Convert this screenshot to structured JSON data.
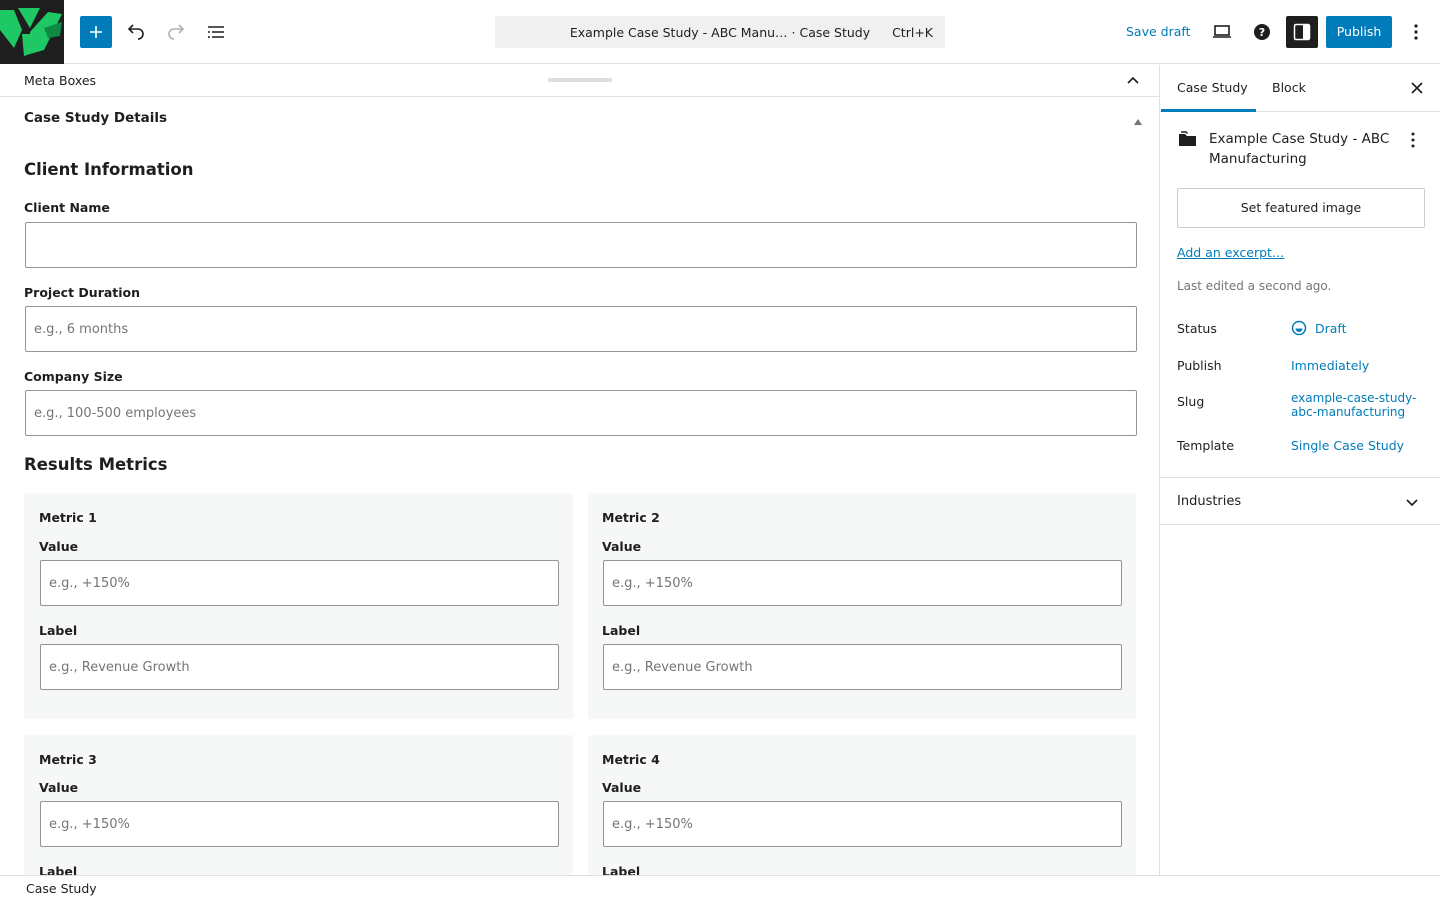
{
  "header": {
    "logo_icon": "site-logo-icon",
    "add_icon": "plus-icon",
    "undo_icon": "undo-icon",
    "redo_icon": "redo-icon",
    "list_view_icon": "list-view-icon",
    "command_title": "Example Case Study - ABC Manu… · Case Study",
    "command_shortcut": "Ctrl+K",
    "save_draft": "Save draft",
    "preview_icon": "laptop-icon",
    "help_icon": "help-icon",
    "settings_icon": "sidebar-toggle-icon",
    "publish": "Publish",
    "more_icon": "more-vertical-icon",
    "accent_color": "#007cba"
  },
  "meta_boxes": {
    "title": "Meta Boxes",
    "panel_title": "Case Study Details",
    "client_section": "Client Information",
    "fields": [
      {
        "label": "Client Name",
        "value": "",
        "placeholder": ""
      },
      {
        "label": "Project Duration",
        "value": "",
        "placeholder": "e.g., 6 months"
      },
      {
        "label": "Company Size",
        "value": "",
        "placeholder": "e.g., 100-500 employees"
      }
    ],
    "results_section": "Results Metrics",
    "metrics": [
      {
        "title": "Metric 1",
        "value_label": "Value",
        "value_placeholder": "e.g., +150%",
        "label_label": "Label",
        "label_placeholder": "e.g., Revenue Growth"
      },
      {
        "title": "Metric 2",
        "value_label": "Value",
        "value_placeholder": "e.g., +150%",
        "label_label": "Label",
        "label_placeholder": "e.g., Revenue Growth"
      },
      {
        "title": "Metric 3",
        "value_label": "Value",
        "value_placeholder": "e.g., +150%",
        "label_label": "Label"
      },
      {
        "title": "Metric 4",
        "value_label": "Value",
        "value_placeholder": "e.g., +150%",
        "label_label": "Label"
      }
    ]
  },
  "sidebar": {
    "tabs": [
      "Case Study",
      "Block"
    ],
    "post_title": "Example Case Study - ABC Manufacturing",
    "featured_image": "Set featured image",
    "excerpt": "Add an excerpt…",
    "last_edited": "Last edited a second ago.",
    "rows": {
      "status_label": "Status",
      "status_value": "Draft",
      "publish_label": "Publish",
      "publish_value": "Immediately",
      "slug_label": "Slug",
      "slug_value": "example-case-study-abc-manufacturing",
      "template_label": "Template",
      "template_value": "Single Case Study"
    },
    "industries": "Industries"
  },
  "footer": {
    "breadcrumb": "Case Study"
  }
}
